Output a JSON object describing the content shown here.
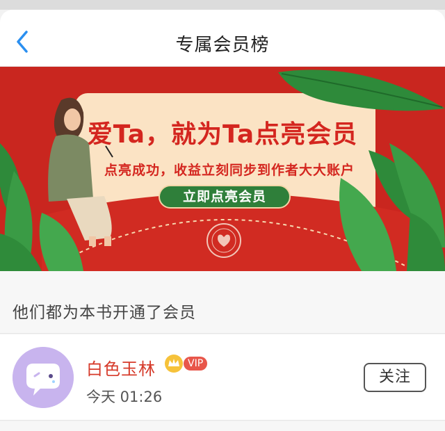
{
  "nav": {
    "title": "专属会员榜",
    "back_icon": "chevron-left-icon",
    "accent": "#2a8ff0"
  },
  "banner": {
    "headline": "爱Ta，就为Ta点亮会员",
    "subtitle": "点亮成功，收益立刻同步到作者大大账户",
    "cta_label": "立即点亮会员",
    "colors": {
      "background": "#c9261f",
      "card": "#fbe3c4",
      "cta": "#2f7f3a"
    }
  },
  "section": {
    "title": "他们都为本书开通了会员"
  },
  "members": [
    {
      "name": "白色玉林",
      "badge": "VIP",
      "time": "今天 01:26",
      "follow_label": "关注",
      "avatar_icon": "chat-bubble-face-icon",
      "name_color": "#d63a2a"
    }
  ]
}
